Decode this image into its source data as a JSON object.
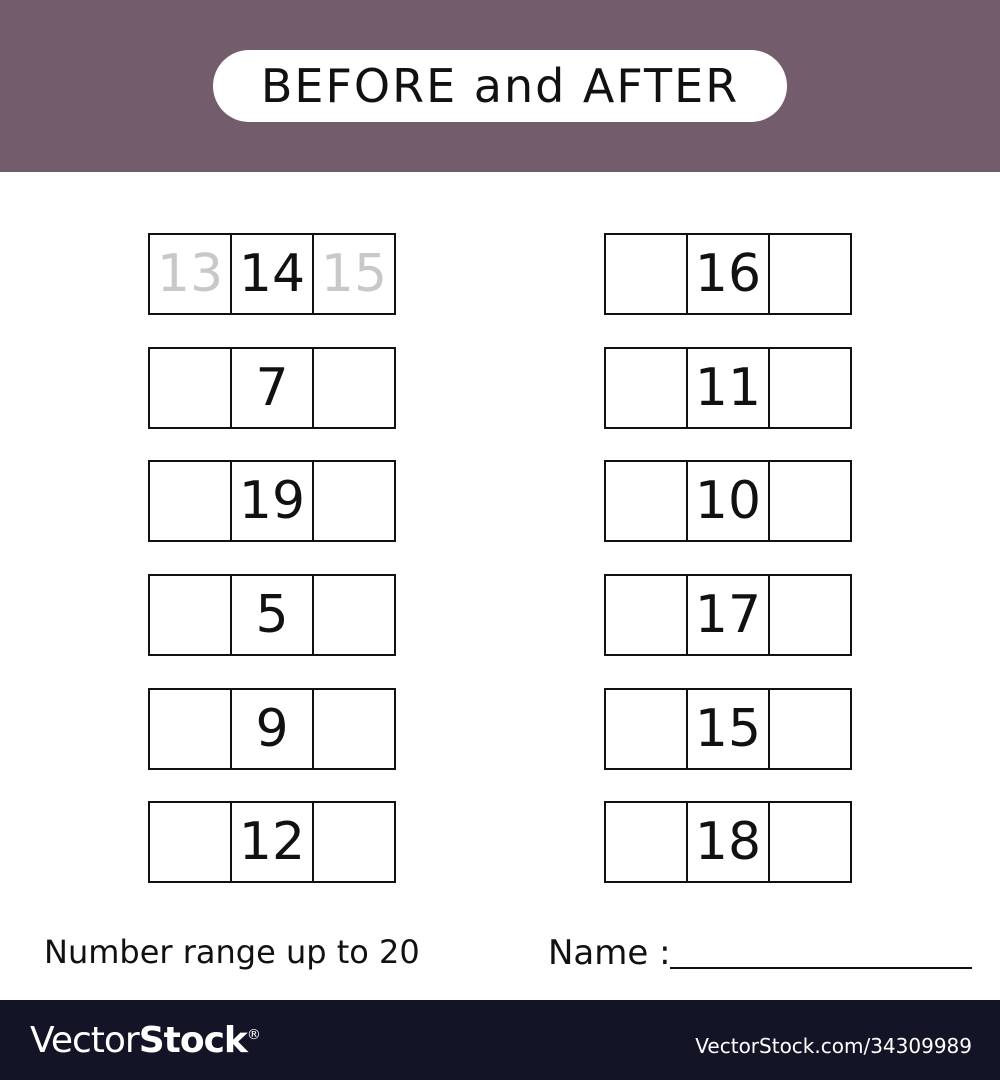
{
  "title": "BEFORE and AFTER",
  "colors": {
    "header": "#735c6b",
    "footer": "#131527",
    "hint": "#c8c8c8"
  },
  "example": {
    "before": "13",
    "number": "14",
    "after": "15"
  },
  "left_numbers": [
    "7",
    "19",
    "5",
    "9",
    "12"
  ],
  "right_numbers": [
    "16",
    "11",
    "10",
    "17",
    "15",
    "18"
  ],
  "range_label": "Number range up to 20",
  "name_label": "Name :",
  "footer": {
    "logo_light": "Vector",
    "logo_bold": "Stock",
    "logo_mark": "®",
    "ref": "VectorStock.com/34309989"
  }
}
